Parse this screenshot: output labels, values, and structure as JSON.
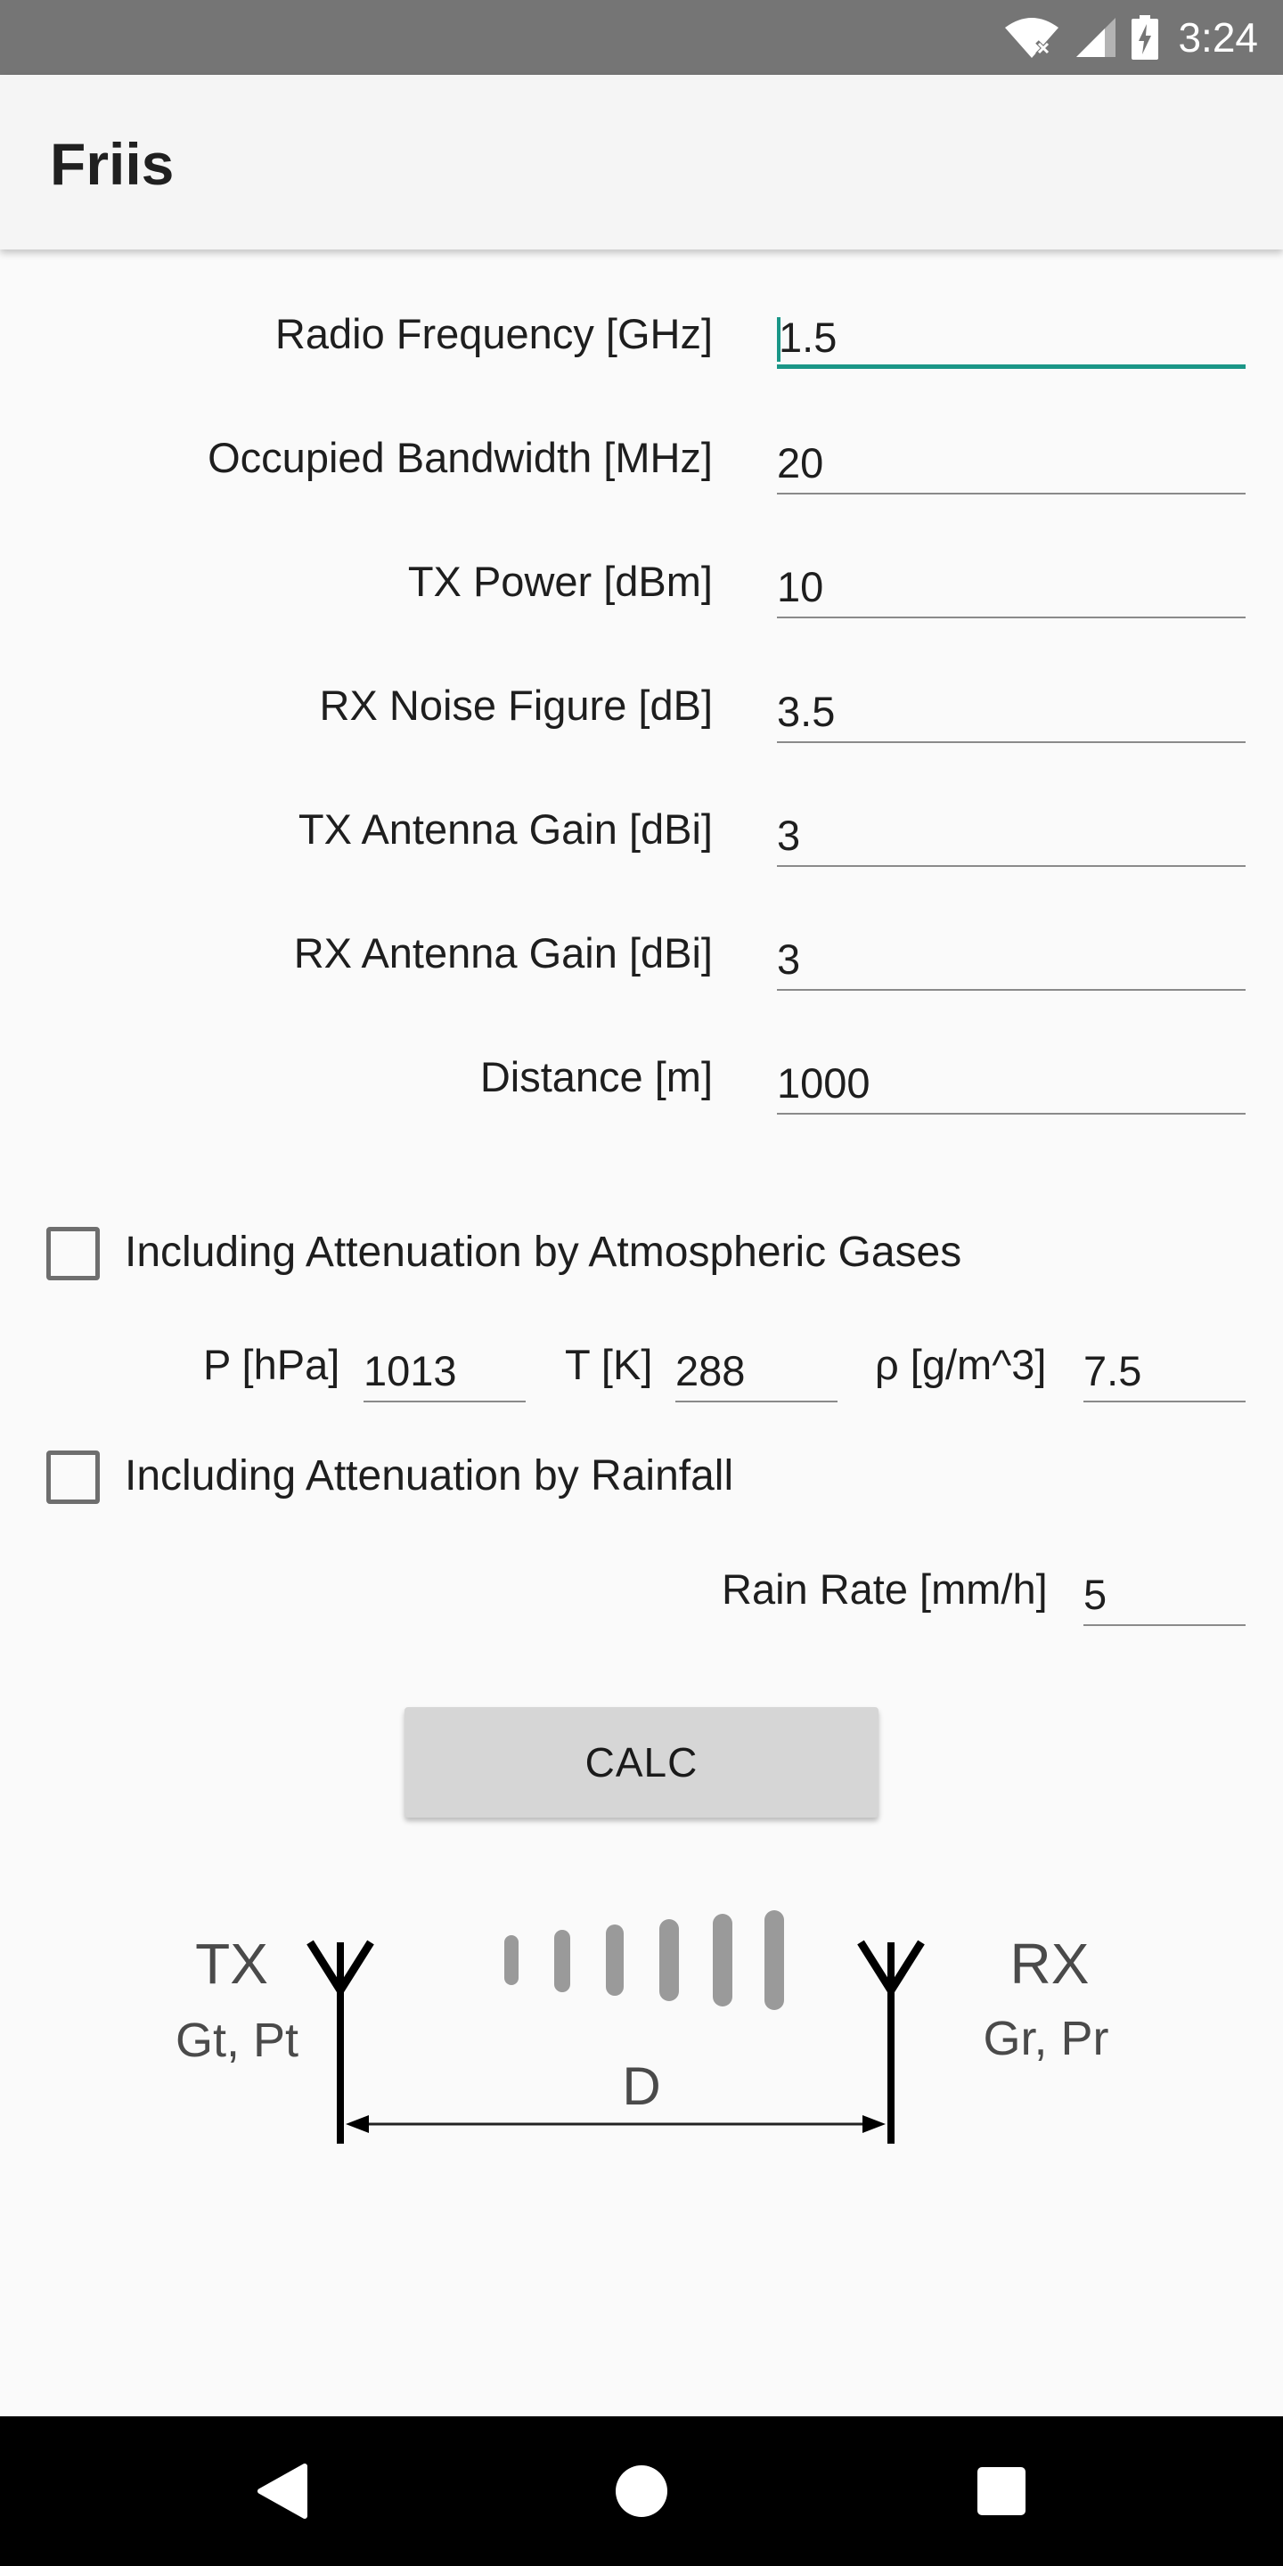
{
  "status_bar": {
    "time": "3:24",
    "icons": [
      "wifi-off-icon",
      "cell-signal-icon",
      "battery-charging-icon"
    ]
  },
  "app": {
    "title": "Friis"
  },
  "form": {
    "radio_frequency": {
      "label": "Radio Frequency [GHz]",
      "value": "1.5",
      "focused": true
    },
    "occupied_bandwidth": {
      "label": "Occupied Bandwidth [MHz]",
      "value": "20"
    },
    "tx_power": {
      "label": "TX Power [dBm]",
      "value": "10"
    },
    "rx_noise_figure": {
      "label": "RX Noise Figure [dB]",
      "value": "3.5"
    },
    "tx_antenna_gain": {
      "label": "TX Antenna Gain [dBi]",
      "value": "3"
    },
    "rx_antenna_gain": {
      "label": "RX Antenna Gain [dBi]",
      "value": "3"
    },
    "distance": {
      "label": "Distance [m]",
      "value": "1000"
    }
  },
  "atmospheric": {
    "checkbox_label": "Including Attenuation by Atmospheric Gases",
    "checked": false,
    "pressure": {
      "label": "P [hPa]",
      "value": "1013"
    },
    "temperature": {
      "label": "T [K]",
      "value": "288"
    },
    "density": {
      "label": "ρ [g/m^3]",
      "value": "7.5"
    }
  },
  "rainfall": {
    "checkbox_label": "Including Attenuation by Rainfall",
    "checked": false,
    "rain_rate": {
      "label": "Rain Rate [mm/h]",
      "value": "5"
    }
  },
  "calc_button": {
    "label": "CALC"
  },
  "diagram": {
    "tx_label": "TX",
    "tx_params": "Gt, Pt",
    "rx_label": "RX",
    "rx_params": "Gr, Pr",
    "distance_label": "D"
  },
  "nav_bar": {
    "icons": [
      "back-icon",
      "home-icon",
      "recents-icon"
    ]
  },
  "colors": {
    "accent": "#1a9687",
    "status_bar": "#757575",
    "app_bar": "#f5f5f5",
    "background": "#fafafa",
    "button": "#d6d6d6"
  }
}
